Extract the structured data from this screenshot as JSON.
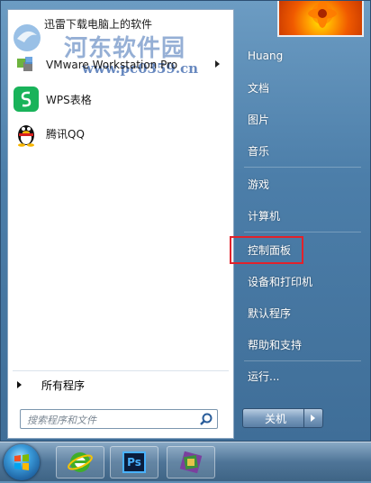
{
  "watermark": {
    "title": "河东软件园",
    "url": "www.pc0359.cn",
    "recent_text": "迅雷下载电脑上的软件"
  },
  "left_panel": {
    "items": [
      {
        "label": "VMware Workstation Pro",
        "icon": "vmware-icon",
        "has_submenu": true
      },
      {
        "label": "WPS表格",
        "icon": "wps-spreadsheet-icon",
        "has_submenu": false
      },
      {
        "label": "腾讯QQ",
        "icon": "qq-penguin-icon",
        "has_submenu": false
      }
    ],
    "all_programs": "所有程序"
  },
  "search": {
    "placeholder": "搜索程序和文件"
  },
  "right_panel": {
    "items": [
      {
        "label": "Huang"
      },
      {
        "label": "文档"
      },
      {
        "label": "图片"
      },
      {
        "label": "音乐"
      },
      {
        "label": "游戏"
      },
      {
        "label": "计算机"
      },
      {
        "label": "控制面板"
      },
      {
        "label": "设备和打印机"
      },
      {
        "label": "默认程序"
      },
      {
        "label": "帮助和支持"
      },
      {
        "label": "运行..."
      }
    ]
  },
  "shutdown": {
    "label": "关机"
  },
  "taskbar": {
    "items": [
      {
        "icon": "start-orb-icon"
      },
      {
        "icon": "internet-explorer-icon"
      },
      {
        "icon": "photoshop-icon",
        "text": "Ps"
      },
      {
        "icon": "winrar-icon"
      }
    ]
  },
  "colors": {
    "highlight_box": "#e2222b",
    "menu_blue": "#4c7ea9"
  }
}
